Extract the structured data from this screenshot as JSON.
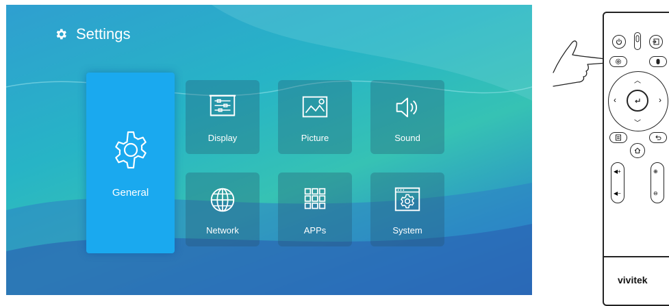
{
  "screen": {
    "title": "Settings",
    "tiles": [
      {
        "label": "General",
        "icon": "gear-icon"
      },
      {
        "label": "Display",
        "icon": "projection-screen-icon"
      },
      {
        "label": "Picture",
        "icon": "picture-icon"
      },
      {
        "label": "Sound",
        "icon": "speaker-icon"
      },
      {
        "label": "Network",
        "icon": "globe-icon"
      },
      {
        "label": "APPs",
        "icon": "apps-grid-icon"
      },
      {
        "label": "System",
        "icon": "system-settings-icon"
      }
    ],
    "colors": {
      "selected_tile": "#1aa9ef",
      "background_top": "#2f9fd0",
      "background_bottom": "#2b6cb8"
    }
  },
  "remote": {
    "brand": "vivitek",
    "buttons": [
      "power-icon",
      "mouse-icon",
      "input-source-icon",
      "settings-icon",
      "mouse-icon",
      "arrow-up-icon",
      "arrow-left-icon",
      "enter-icon",
      "arrow-right-icon",
      "arrow-down-icon",
      "menu-icon",
      "back-icon",
      "home-icon",
      "volume-up-icon",
      "volume-down-icon",
      "zoom-in-icon",
      "zoom-out-icon"
    ]
  }
}
